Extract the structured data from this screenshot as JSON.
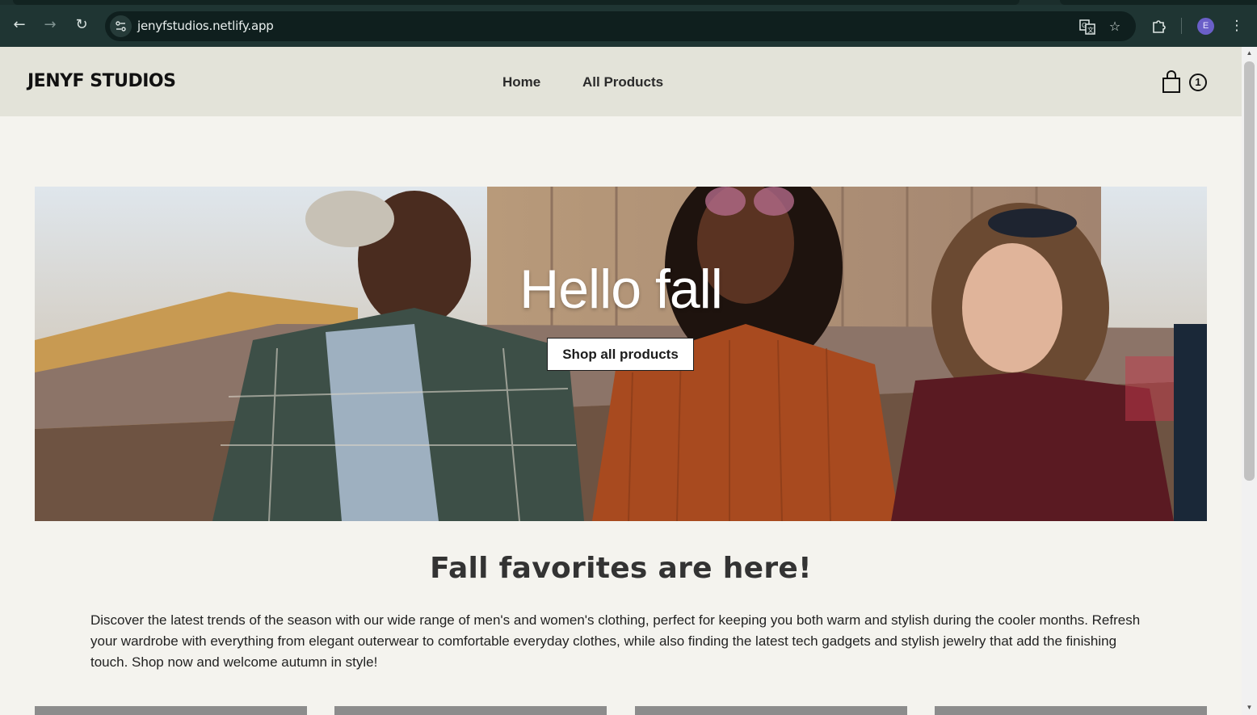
{
  "browser": {
    "url": "jenyfstudios.netlify.app",
    "profile_initial": "E"
  },
  "site": {
    "logo": "JENYF STUDIOS",
    "nav": [
      "Home",
      "All Products"
    ],
    "cart_count": "1"
  },
  "hero": {
    "title": "Hello fall",
    "button_label": "Shop all products"
  },
  "intro": {
    "heading": "Fall favorites are here!",
    "body": "Discover the latest trends of the season with our wide range of men's and women's clothing, perfect for keeping you both warm and stylish during the cooler months. Refresh your wardrobe with everything from elegant outerwear to comfortable everyday clothes, while also finding the latest tech gadgets and stylish jewelry that add the finishing touch. Shop now and welcome autumn in style!"
  },
  "colors": {
    "header_bg": "#e3e3d9",
    "page_bg": "#f4f3ee",
    "browser_bg": "#1f3533"
  },
  "icons": [
    "back-arrow-icon",
    "forward-arrow-icon",
    "reload-icon",
    "site-info-icon",
    "translate-icon",
    "bookmark-star-icon",
    "extensions-icon",
    "menu-dots-icon",
    "shopping-bag-icon"
  ]
}
